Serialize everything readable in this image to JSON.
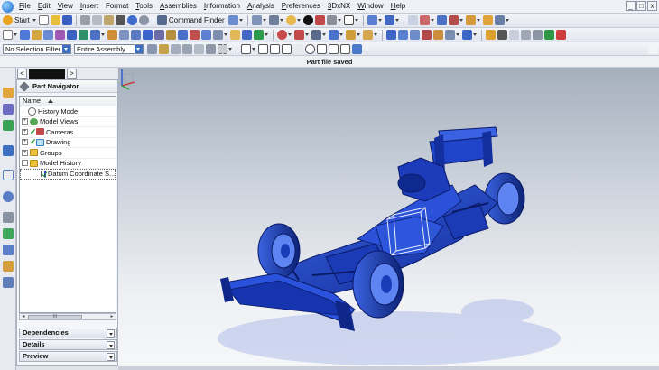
{
  "menu": {
    "items": [
      {
        "key": "F",
        "rest": "ile"
      },
      {
        "key": "E",
        "rest": "dit"
      },
      {
        "key": "V",
        "rest": "iew"
      },
      {
        "key": "I",
        "rest": "nsert"
      },
      {
        "key": "F",
        "rest": "ormat",
        "pre": "",
        "alt": "Format"
      },
      {
        "key": "T",
        "rest": "ools"
      },
      {
        "key": "A",
        "rest": "ssemblies"
      },
      {
        "key": "I",
        "rest": "nformation"
      },
      {
        "key": "A",
        "rest": "nalysis"
      },
      {
        "key": "P",
        "rest": "references"
      },
      {
        "key": "3",
        "rest": "DxNX"
      },
      {
        "key": "W",
        "rest": "indow"
      },
      {
        "key": "H",
        "rest": "elp"
      }
    ]
  },
  "window_controls": {
    "minimize": "_",
    "restore": "□",
    "close": "x"
  },
  "toolbar": {
    "start_label": "Start",
    "command_finder_label": "Command Finder",
    "selection_filter": "No Selection Filter",
    "assembly_scope": "Entire Assembly"
  },
  "status": {
    "message": "Part file saved"
  },
  "resource_bar": {
    "back_arrow": "<",
    "forward_arrow": ">",
    "icons": [
      "part-navigator-icon",
      "assembly-navigator-icon",
      "constraint-navigator-icon",
      "reuse-library-icon",
      "web-browser-icon",
      "history-icon",
      "system-materials-icon",
      "process-studio-icon",
      "manufacturing-wizards-icon",
      "roles-icon",
      "system-scenes-icon"
    ]
  },
  "navigator": {
    "title": "Part Navigator",
    "column_name": "Name",
    "tree": [
      {
        "label": "History Mode",
        "icon": "clock-icon",
        "expander": "",
        "checked": false
      },
      {
        "label": "Model Views",
        "icon": "model-views-icon",
        "expander": "+",
        "checked": false
      },
      {
        "label": "Cameras",
        "icon": "camera-icon",
        "expander": "+",
        "checked": true
      },
      {
        "label": "Drawing",
        "icon": "drawing-icon",
        "expander": "+",
        "checked": true
      },
      {
        "label": "Groups",
        "icon": "folder-icon",
        "expander": "+",
        "checked": false
      },
      {
        "label": "Model History",
        "icon": "folder-icon",
        "expander": "-",
        "checked": false
      },
      {
        "label": "Datum Coordinate S...",
        "icon": "datum-csys-icon",
        "expander": "",
        "checked": true
      }
    ],
    "scroll_thumb": "III",
    "panels": [
      {
        "label": "Dependencies"
      },
      {
        "label": "Details"
      },
      {
        "label": "Preview"
      }
    ]
  },
  "colors": {
    "model_blue": "#1f43c9",
    "model_dark": "#0c1e6b",
    "viewport_top": "#a6afbd",
    "viewport_floor": "#f6f7f8",
    "accent": "#3d6fc2"
  }
}
